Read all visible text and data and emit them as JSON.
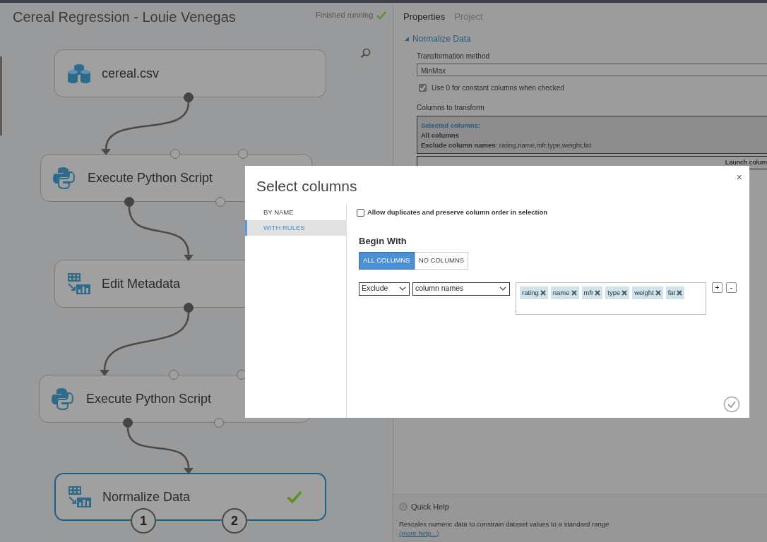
{
  "experiment": {
    "title": "Cereal Regression - Louie Venegas",
    "status": "Finished running",
    "finished": true
  },
  "modules": [
    {
      "label": "cereal.csv",
      "kind": "dataset",
      "selected": false,
      "finished": false,
      "outputs": [
        {
          "connected": true
        }
      ]
    },
    {
      "label": "Execute Python Script",
      "kind": "python",
      "selected": false,
      "finished": false,
      "inputs": [
        {
          "connected": true
        },
        {
          "connected": false
        },
        {
          "connected": false
        }
      ],
      "outputs": [
        {
          "connected": true
        },
        {
          "connected": false
        }
      ]
    },
    {
      "label": "Edit Metadata",
      "kind": "transform",
      "selected": false,
      "finished": false,
      "inputs": [
        {
          "connected": true
        }
      ],
      "outputs": [
        {
          "connected": true
        }
      ]
    },
    {
      "label": "Execute Python Script",
      "kind": "python",
      "selected": false,
      "finished": false,
      "inputs": [
        {
          "connected": true
        },
        {
          "connected": false
        },
        {
          "connected": false
        }
      ],
      "outputs": [
        {
          "connected": true
        },
        {
          "connected": false
        }
      ]
    },
    {
      "label": "Normalize Data",
      "kind": "transform",
      "selected": true,
      "finished": true,
      "inputs": [
        {
          "connected": true
        }
      ],
      "outputs": [
        {
          "connected": false,
          "label": "1"
        },
        {
          "connected": false,
          "label": "2"
        }
      ]
    }
  ],
  "panel": {
    "tabs": [
      {
        "label": "Properties",
        "selected": true
      },
      {
        "label": "Project",
        "selected": false
      }
    ],
    "section": {
      "title": "Normalize Data",
      "expanded": true
    },
    "transformation_method": {
      "label": "Transformation method",
      "value": "MinMax"
    },
    "constant_columns": {
      "label": "Use 0 for constant columns when checked",
      "checked": true
    },
    "columns_to_transform": {
      "label": "Columns to transform",
      "heading": "Selected columns:",
      "summary": "All columns",
      "rule": "**Exclude column names**: rating,name,mfr,type,weight,fat"
    },
    "launch_button": "Launch colum",
    "quick_help": {
      "title": "Quick Help",
      "description": "Rescales numeric data to constrain dataset values to a standard range",
      "link": "(more help...)"
    }
  },
  "dialog": {
    "title": "Select columns",
    "close": "×",
    "nav": [
      {
        "label": "BY NAME",
        "selected": false
      },
      {
        "label": "WITH RULES",
        "selected": true
      }
    ],
    "allow_duplicates": {
      "label": "Allow duplicates and preserve column order in selection",
      "checked": false
    },
    "begin_with": {
      "label": "Begin With",
      "options": [
        {
          "label": "ALL COLUMNS",
          "selected": true
        },
        {
          "label": "NO COLUMNS",
          "selected": false
        }
      ]
    },
    "rule": {
      "mode": "Exclude",
      "target": "column names",
      "tags": [
        "rating",
        "name",
        "mfr",
        "type",
        "weight",
        "fat"
      ],
      "add": "+",
      "remove": "-"
    }
  }
}
